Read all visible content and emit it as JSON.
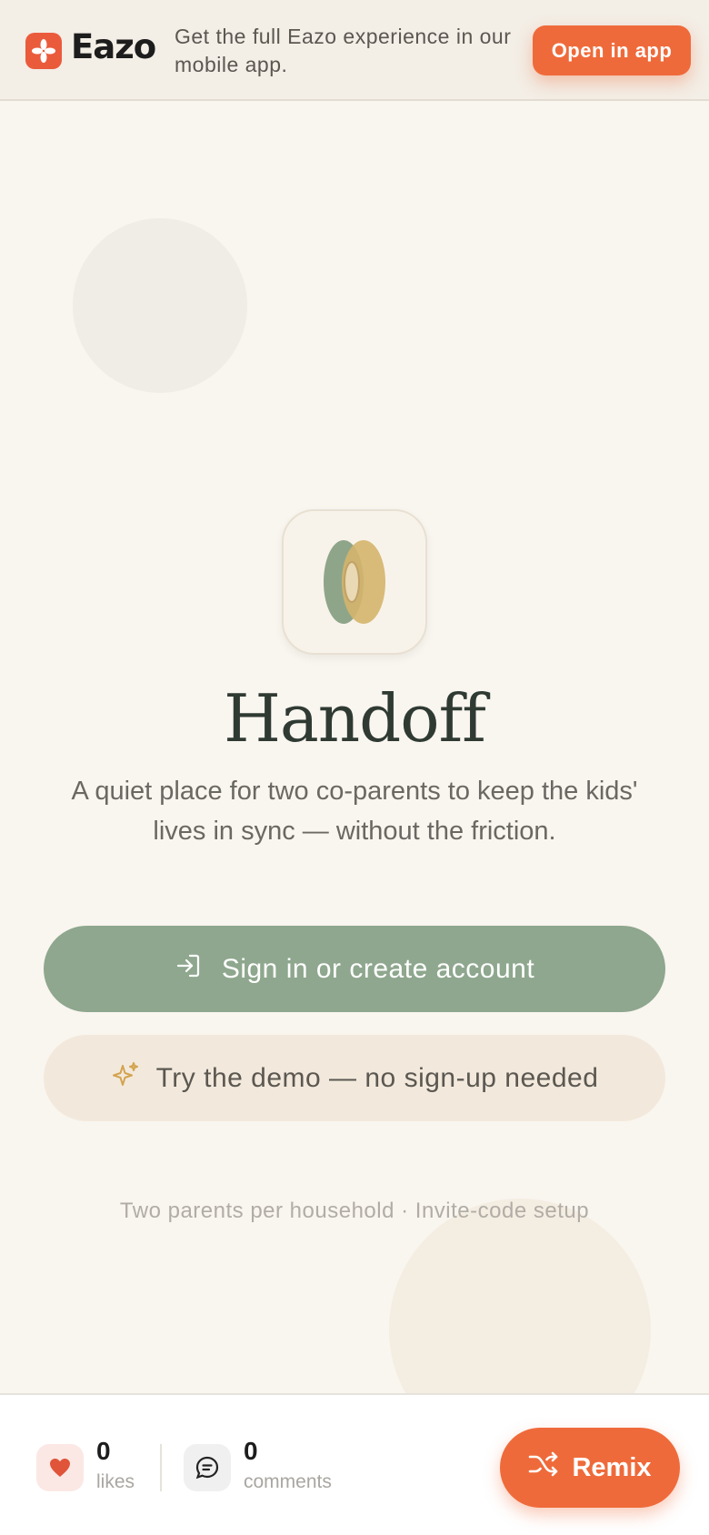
{
  "banner": {
    "brand": "Eazo",
    "message": "Get the full Eazo experience in our mobile app.",
    "open_button": "Open in app"
  },
  "hero": {
    "title": "Handoff",
    "subtitle": "A quiet place for two co-parents to keep the kids' lives in sync — without the friction.",
    "primary_button": "Sign in or create account",
    "secondary_button": "Try the demo — no sign-up needed",
    "footnote": "Two parents per household · Invite-code setup"
  },
  "bottom": {
    "likes_count": "0",
    "likes_label": "likes",
    "comments_count": "0",
    "comments_label": "comments",
    "remix_button": "Remix"
  },
  "colors": {
    "accent": "#ef6a3a",
    "primary_green": "#8ea78e",
    "background": "#f9f5ef"
  }
}
